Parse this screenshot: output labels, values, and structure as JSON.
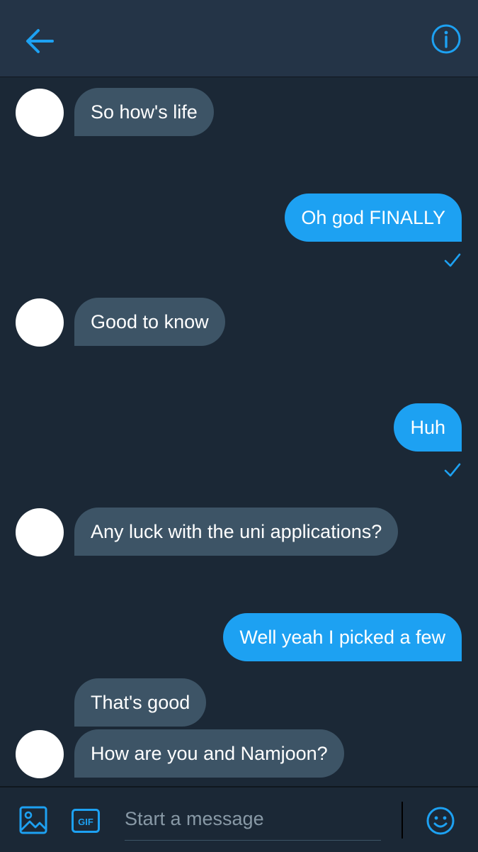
{
  "header": {
    "back_icon": "arrow-left-icon",
    "info_icon": "info-circle-icon",
    "accent_color": "#1da1f2"
  },
  "messages": [
    {
      "side": "in",
      "text": "So how's life",
      "avatar": true
    },
    {
      "side": "out",
      "text": "Oh god FINALLY",
      "seen": true
    },
    {
      "side": "in",
      "text": "Good to know",
      "avatar": true
    },
    {
      "side": "out",
      "text": "Huh",
      "seen": true
    },
    {
      "side": "in",
      "text": "Any luck with the uni applications?",
      "avatar": true
    },
    {
      "side": "out",
      "text": "Well yeah I picked a few"
    },
    {
      "side": "in",
      "text": "That's good"
    },
    {
      "side": "in",
      "text": "How are you and Namjoon?",
      "avatar": true
    }
  ],
  "composer": {
    "placeholder": "Start a message",
    "gif_label": "GIF",
    "media_icon": "image-icon",
    "emoji_icon": "smiley-icon"
  }
}
